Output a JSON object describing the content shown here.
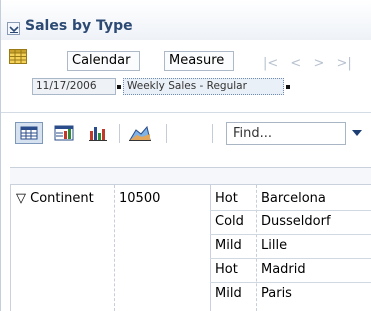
{
  "panel": {
    "title": "Sales by Type"
  },
  "toolbar": {
    "calendar_label": "Calendar",
    "measure_label": "Measure",
    "nav_glyphs": [
      "|<",
      "<",
      ">",
      ">|"
    ]
  },
  "chips": {
    "date": "11/17/2006",
    "measure": "Weekly Sales - Regular"
  },
  "view_toolbar": {
    "find_placeholder": "Find..."
  },
  "grid": {
    "row_header": "Continent",
    "value": "10500",
    "rows": [
      {
        "type": "Hot",
        "city": "Barcelona"
      },
      {
        "type": "Cold",
        "city": "Dusseldorf"
      },
      {
        "type": "Mild",
        "city": "Lille"
      },
      {
        "type": "Hot",
        "city": "Madrid"
      },
      {
        "type": "Mild",
        "city": "Paris"
      }
    ]
  },
  "colors": {
    "title": "#2c4a74",
    "accent_border": "#7e98bb",
    "grid_line": "#c9d1dc"
  }
}
